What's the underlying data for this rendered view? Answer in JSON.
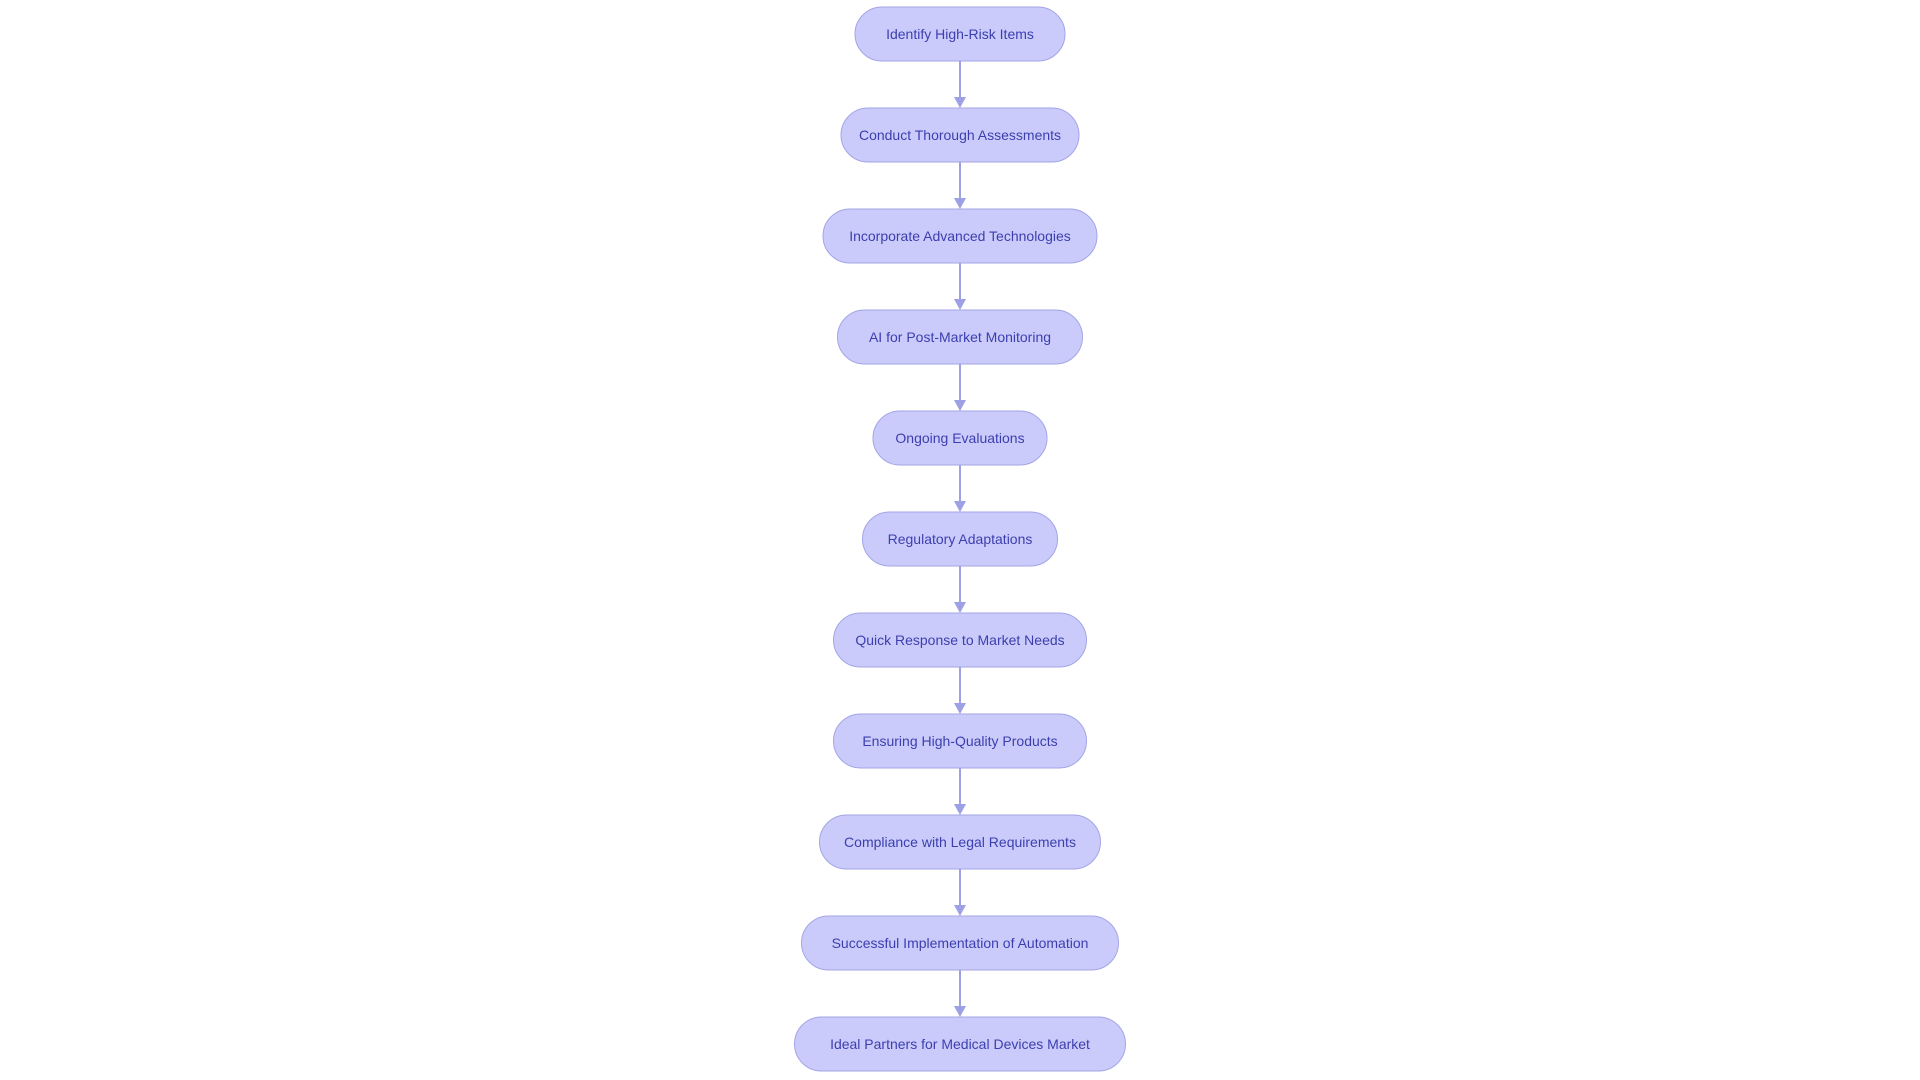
{
  "diagram": {
    "type": "flowchart",
    "direction": "top-to-bottom",
    "colors": {
      "node_fill": "#cbcbfb",
      "node_stroke": "#a3a5e6",
      "node_text": "#3b3fae",
      "edge": "#9da0e4"
    },
    "nodes": [
      {
        "id": "n1",
        "label": "Identify High-Risk Items"
      },
      {
        "id": "n2",
        "label": "Conduct Thorough Assessments"
      },
      {
        "id": "n3",
        "label": "Incorporate Advanced Technologies"
      },
      {
        "id": "n4",
        "label": "AI for Post-Market Monitoring"
      },
      {
        "id": "n5",
        "label": "Ongoing Evaluations"
      },
      {
        "id": "n6",
        "label": "Regulatory Adaptations"
      },
      {
        "id": "n7",
        "label": "Quick Response to Market Needs"
      },
      {
        "id": "n8",
        "label": "Ensuring High-Quality Products"
      },
      {
        "id": "n9",
        "label": "Compliance with Legal Requirements"
      },
      {
        "id": "n10",
        "label": "Successful Implementation of Automation"
      },
      {
        "id": "n11",
        "label": "Ideal Partners for Medical Devices Market"
      }
    ],
    "edges": [
      {
        "from": "n1",
        "to": "n2"
      },
      {
        "from": "n2",
        "to": "n3"
      },
      {
        "from": "n3",
        "to": "n4"
      },
      {
        "from": "n4",
        "to": "n5"
      },
      {
        "from": "n5",
        "to": "n6"
      },
      {
        "from": "n6",
        "to": "n7"
      },
      {
        "from": "n7",
        "to": "n8"
      },
      {
        "from": "n8",
        "to": "n9"
      },
      {
        "from": "n9",
        "to": "n10"
      },
      {
        "from": "n10",
        "to": "n11"
      }
    ]
  }
}
